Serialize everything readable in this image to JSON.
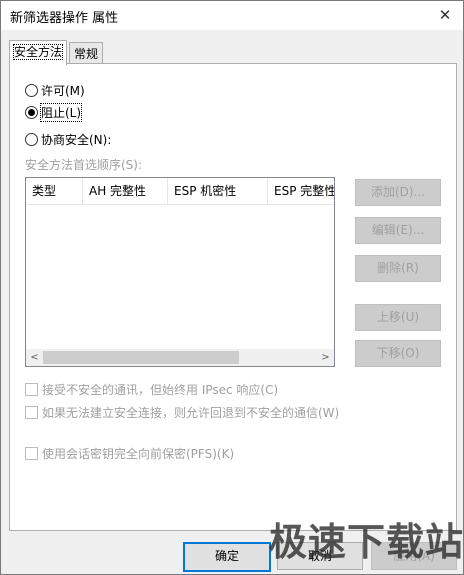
{
  "window": {
    "title": "新筛选器操作 属性",
    "close_glyph": "✕"
  },
  "tabs": [
    {
      "label": "安全方法",
      "active": true
    },
    {
      "label": "常规",
      "active": false
    }
  ],
  "radios": [
    {
      "label": "许可(M)",
      "checked": false
    },
    {
      "label": "阻止(L)",
      "checked": true
    },
    {
      "label": "协商安全(N):",
      "checked": false
    }
  ],
  "list": {
    "label": "安全方法首选顺序(S):",
    "columns": [
      "类型",
      "AH 完整性",
      "ESP 机密性",
      "ESP 完整性"
    ],
    "scroll_left": "<",
    "scroll_right": ">"
  },
  "side_buttons": [
    "添加(D)...",
    "编辑(E)...",
    "删除(R)",
    "上移(U)",
    "下移(O)"
  ],
  "checkboxes": [
    {
      "label": "接受不安全的通讯，但始终用 IPsec 响应(C)",
      "checked": false
    },
    {
      "label": "如果无法建立安全连接，则允许回退到不安全的通信(W)",
      "checked": false
    },
    {
      "label": "使用会话密钥完全向前保密(PFS)(K)",
      "checked": false
    }
  ],
  "bottom_buttons": {
    "ok": "确定",
    "cancel": "取消",
    "apply": "应用(A)"
  },
  "watermark": "极速下载站",
  "colors": {
    "accent": "#0078d7",
    "disabled_text": "#a0a0a0",
    "dialog_bg": "#f0f0f0"
  }
}
